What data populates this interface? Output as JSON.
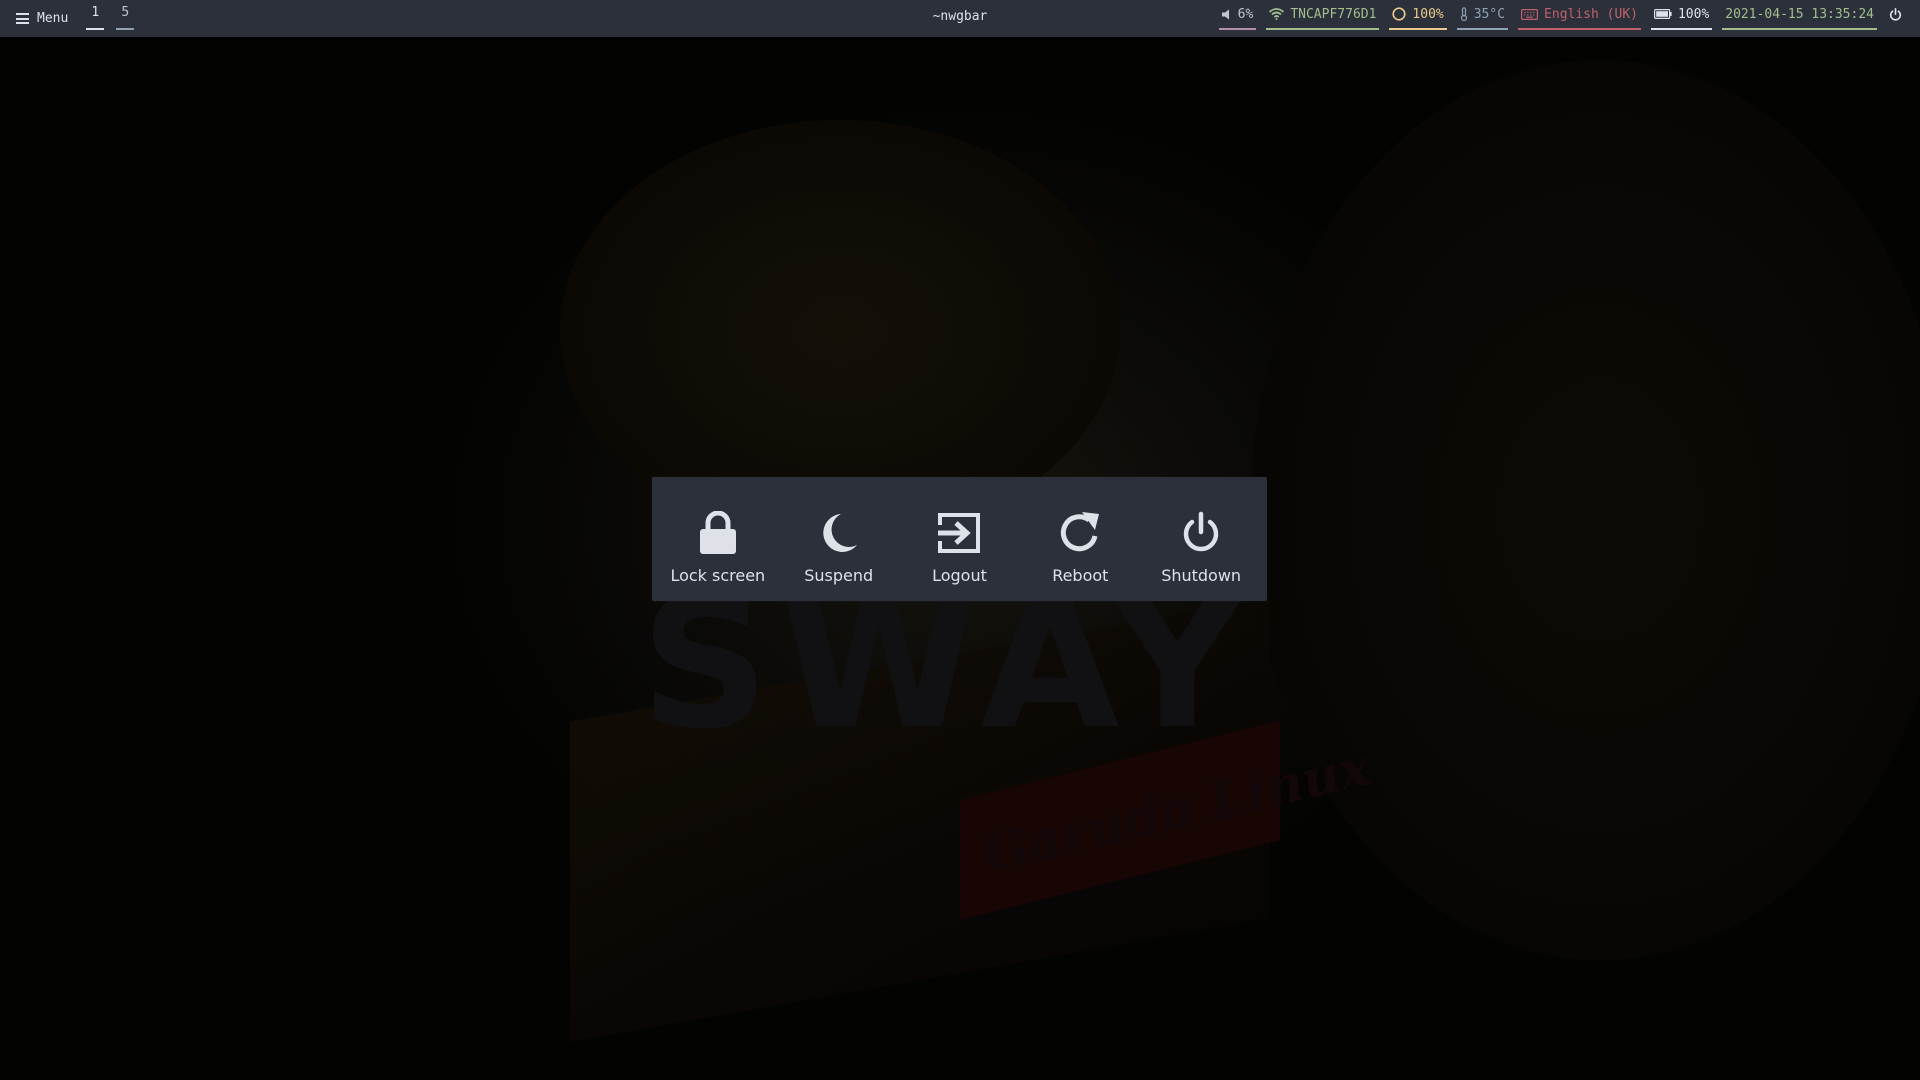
{
  "topbar": {
    "menu_label": "Menu",
    "workspaces": [
      {
        "label": "1",
        "active": true
      },
      {
        "label": "5",
        "active": false
      }
    ],
    "window_title": "~nwgbar",
    "modules": {
      "volume": {
        "icon": "speaker-icon",
        "text": "6%"
      },
      "wifi": {
        "icon": "wifi-icon",
        "text": "TNCAPF776D1"
      },
      "cpu": {
        "icon": "circle-icon",
        "text": "100%"
      },
      "temperature": {
        "icon": "thermometer-icon",
        "text": "35°C"
      },
      "keyboard": {
        "icon": "keyboard-icon",
        "text": "English (UK)"
      },
      "battery": {
        "icon": "battery-icon",
        "text": "100%"
      },
      "clock": {
        "text": "2021-04-15 13:35:24"
      },
      "power": {
        "icon": "power-icon"
      }
    }
  },
  "dialog": {
    "actions": [
      {
        "id": "lock",
        "label": "Lock screen",
        "icon": "lock-icon"
      },
      {
        "id": "suspend",
        "label": "Suspend",
        "icon": "moon-icon"
      },
      {
        "id": "logout",
        "label": "Logout",
        "icon": "logout-icon"
      },
      {
        "id": "reboot",
        "label": "Reboot",
        "icon": "reboot-icon"
      },
      {
        "id": "shutdown",
        "label": "Shutdown",
        "icon": "power-icon"
      }
    ]
  },
  "wallpaper": {
    "logo_text": "SWAY",
    "box_text": "Garuda Linux"
  },
  "colors": {
    "bar_bg": "#2b303b",
    "text": "#dfe1e8",
    "green": "#a3be8c",
    "yellow": "#ebcb8b",
    "red": "#bf616a",
    "purple": "#b48ead",
    "blue": "#8fa1b3"
  }
}
